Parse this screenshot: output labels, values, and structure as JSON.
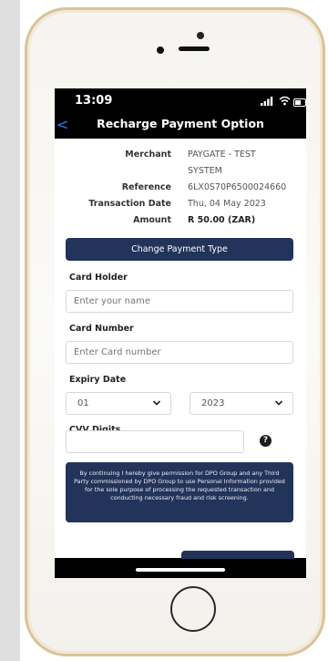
{
  "status": {
    "time": "13:09"
  },
  "nav": {
    "back": "<",
    "title": "Recharge Payment Option"
  },
  "details": {
    "merchant_label": "Merchant",
    "merchant_value_1": "PAYGATE - TEST",
    "merchant_value_2": "SYSTEM",
    "reference_label": "Reference",
    "reference_value": "6LX0S70P6500024660",
    "date_label": "Transaction Date",
    "date_value": "Thu, 04 May 2023",
    "amount_label": "Amount",
    "amount_value": "R 50.00 (ZAR)"
  },
  "actions": {
    "change_payment": "Change Payment Type"
  },
  "form": {
    "card_holder_label": "Card Holder",
    "card_holder_placeholder": "Enter your name",
    "card_number_label": "Card Number",
    "card_number_placeholder": "Enter Card number",
    "expiry_label": "Expiry Date",
    "expiry_month": "01",
    "expiry_year": "2023",
    "cvv_label": "CVV Digits",
    "help_symbol": "?"
  },
  "notice": "By continuing I hereby give permission for DPO Group and any Third Party commissioned by DPO Group to use Personal Information provided for the sole purpose of processing the requested transaction and conducting necessary fraud and risk screening.",
  "colors": {
    "primary": "#23345a",
    "back": "#1a82ff"
  }
}
